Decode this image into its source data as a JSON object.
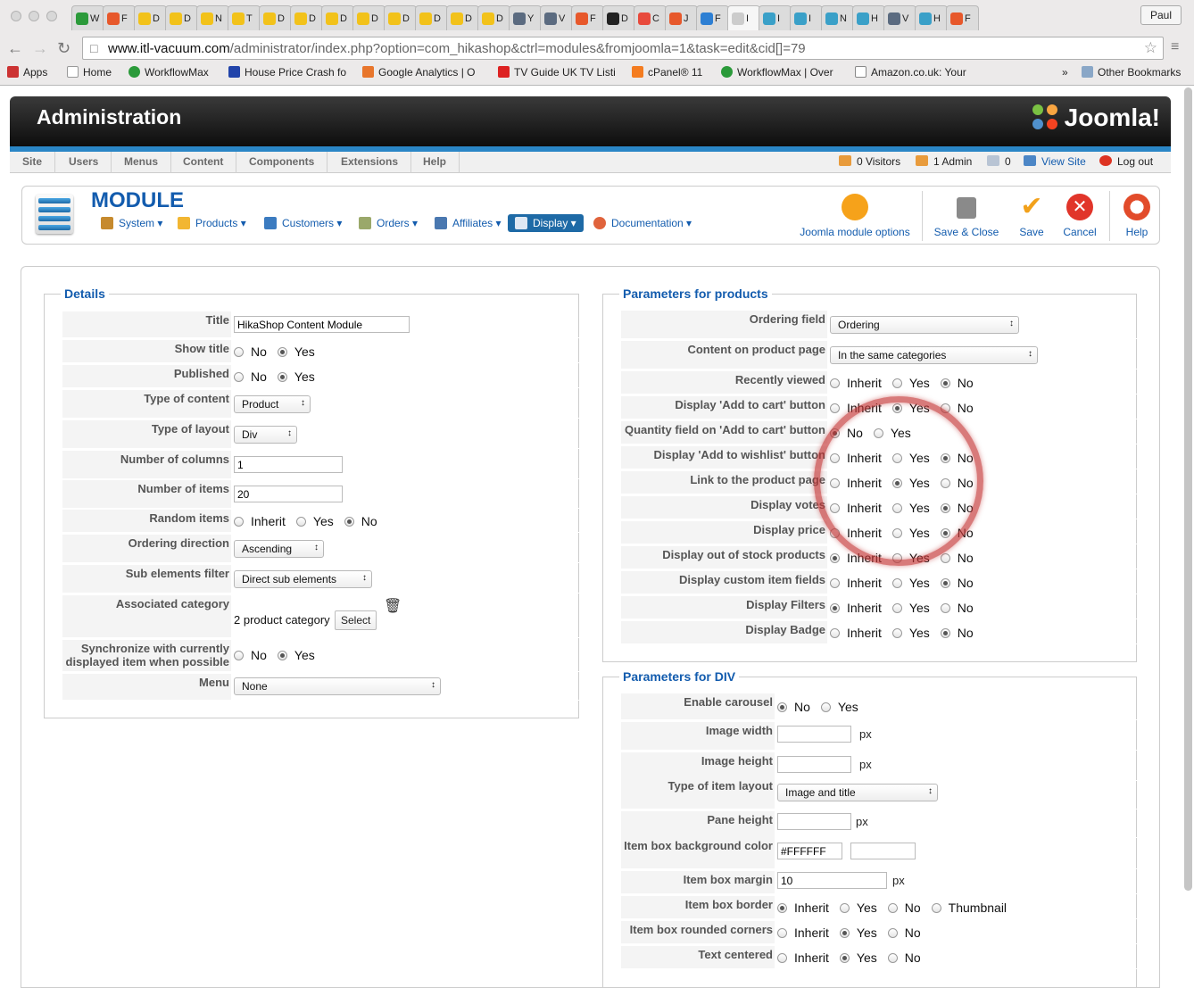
{
  "browser": {
    "tabs": [
      {
        "label": "W",
        "color": "#2b9a3a"
      },
      {
        "label": "F",
        "color": "#e7582b"
      },
      {
        "label": "D",
        "color": "#f2c21a"
      },
      {
        "label": "D",
        "color": "#f2c21a"
      },
      {
        "label": "N",
        "color": "#f2c21a"
      },
      {
        "label": "T",
        "color": "#f2c21a"
      },
      {
        "label": "D",
        "color": "#f2c21a"
      },
      {
        "label": "D",
        "color": "#f2c21a"
      },
      {
        "label": "D",
        "color": "#f2c21a"
      },
      {
        "label": "D",
        "color": "#f2c21a"
      },
      {
        "label": "D",
        "color": "#f2c21a"
      },
      {
        "label": "D",
        "color": "#f2c21a"
      },
      {
        "label": "D",
        "color": "#f2c21a"
      },
      {
        "label": "D",
        "color": "#f2c21a"
      },
      {
        "label": "Y",
        "color": "#5b6b80"
      },
      {
        "label": "V",
        "color": "#5b6b80"
      },
      {
        "label": "F",
        "color": "#e7582b"
      },
      {
        "label": "D",
        "color": "#222222"
      },
      {
        "label": "C",
        "color": "#e84a3c"
      },
      {
        "label": "J",
        "color": "#e7582b"
      },
      {
        "label": "F",
        "color": "#2d7fd3"
      },
      {
        "label": "I",
        "color": "#cccccc"
      },
      {
        "label": "I",
        "color": "#3aa0c8"
      },
      {
        "label": "I",
        "color": "#3aa0c8"
      },
      {
        "label": "N",
        "color": "#3aa0c8"
      },
      {
        "label": "H",
        "color": "#3aa0c8"
      },
      {
        "label": "V",
        "color": "#5b6b80"
      },
      {
        "label": "H",
        "color": "#3aa0c8"
      },
      {
        "label": "F",
        "color": "#e7582b"
      }
    ],
    "profile": "Paul",
    "url_host": "www.itl-vacuum.com",
    "url_path": "/administrator/index.php?option=com_hikashop&ctrl=modules&fromjoomla=1&task=edit&cid[]=79",
    "bookmarks": [
      "Apps",
      "Home",
      "WorkflowMax",
      "House Price Crash fo",
      "Google Analytics | O",
      "TV Guide UK TV Listi",
      "cPanel® 11",
      "WorkflowMax | Over",
      "Amazon.co.uk: Your"
    ],
    "bookmarks_more": "»",
    "other_bookmarks": "Other Bookmarks"
  },
  "admin": {
    "title": "Administration",
    "logo_text": "Joomla!",
    "menu": [
      "Site",
      "Users",
      "Menus",
      "Content",
      "Components",
      "Extensions",
      "Help"
    ],
    "status": {
      "visitors": "0 Visitors",
      "admins": "1 Admin",
      "messages": "0",
      "view_site": "View Site",
      "logout": "Log out"
    }
  },
  "toolbar": {
    "title": "MODULE",
    "hika_menu": [
      "System ▾",
      "Products ▾",
      "Customers ▾",
      "Orders ▾",
      "Affiliates ▾",
      "Display ▾",
      "Documentation ▾"
    ],
    "buttons": {
      "joomla_options": "Joomla module options",
      "save_close": "Save & Close",
      "save": "Save",
      "cancel": "Cancel",
      "help": "Help"
    }
  },
  "details": {
    "legend": "Details",
    "title_label": "Title",
    "title_value": "HikaShop Content Module",
    "show_title_label": "Show title",
    "published_label": "Published",
    "type_content_label": "Type of content",
    "type_content_value": "Product",
    "type_layout_label": "Type of layout",
    "type_layout_value": "Div",
    "num_columns_label": "Number of columns",
    "num_columns_value": "1",
    "num_items_label": "Number of items",
    "num_items_value": "20",
    "random_label": "Random items",
    "ordering_dir_label": "Ordering direction",
    "ordering_dir_value": "Ascending",
    "sub_filter_label": "Sub elements filter",
    "sub_filter_value": "Direct sub elements",
    "assoc_cat_label": "Associated category",
    "assoc_cat_value": "2 product category",
    "select_button": "Select",
    "sync_label": "Synchronize with currently displayed item when possible",
    "menu_label": "Menu",
    "menu_value": "None"
  },
  "options": {
    "no": "No",
    "yes": "Yes",
    "inherit": "Inherit",
    "thumbnail": "Thumbnail"
  },
  "products": {
    "legend": "Parameters for products",
    "ordering_label": "Ordering field",
    "ordering_value": "Ordering",
    "content_label": "Content on product page",
    "content_value": "In the same categories",
    "recently_label": "Recently viewed",
    "add_cart_label": "Display 'Add to cart' button",
    "qty_label": "Quantity field on 'Add to cart' button",
    "wishlist_label": "Display 'Add to wishlist' button",
    "link_label": "Link to the product page",
    "votes_label": "Display votes",
    "price_label": "Display price",
    "stock_label": "Display out of stock products",
    "custom_label": "Display custom item fields",
    "filters_label": "Display Filters",
    "badge_label": "Display Badge"
  },
  "div": {
    "legend": "Parameters for DIV",
    "carousel_label": "Enable carousel",
    "img_width_label": "Image width",
    "img_height_label": "Image height",
    "unit": "px",
    "item_layout_label": "Type of item layout",
    "item_layout_value": "Image and title",
    "pane_height_label": "Pane height",
    "bg_color_label": "Item box background color",
    "bg_color_value": "#FFFFFF",
    "margin_label": "Item box margin",
    "margin_value": "10",
    "border_label": "Item box border",
    "rounded_label": "Item box rounded corners",
    "centered_label": "Text centered"
  },
  "colors": {
    "accent": "#135cae",
    "joomla_blue": "#2a86c6",
    "annotation_circle": "#c03232"
  }
}
